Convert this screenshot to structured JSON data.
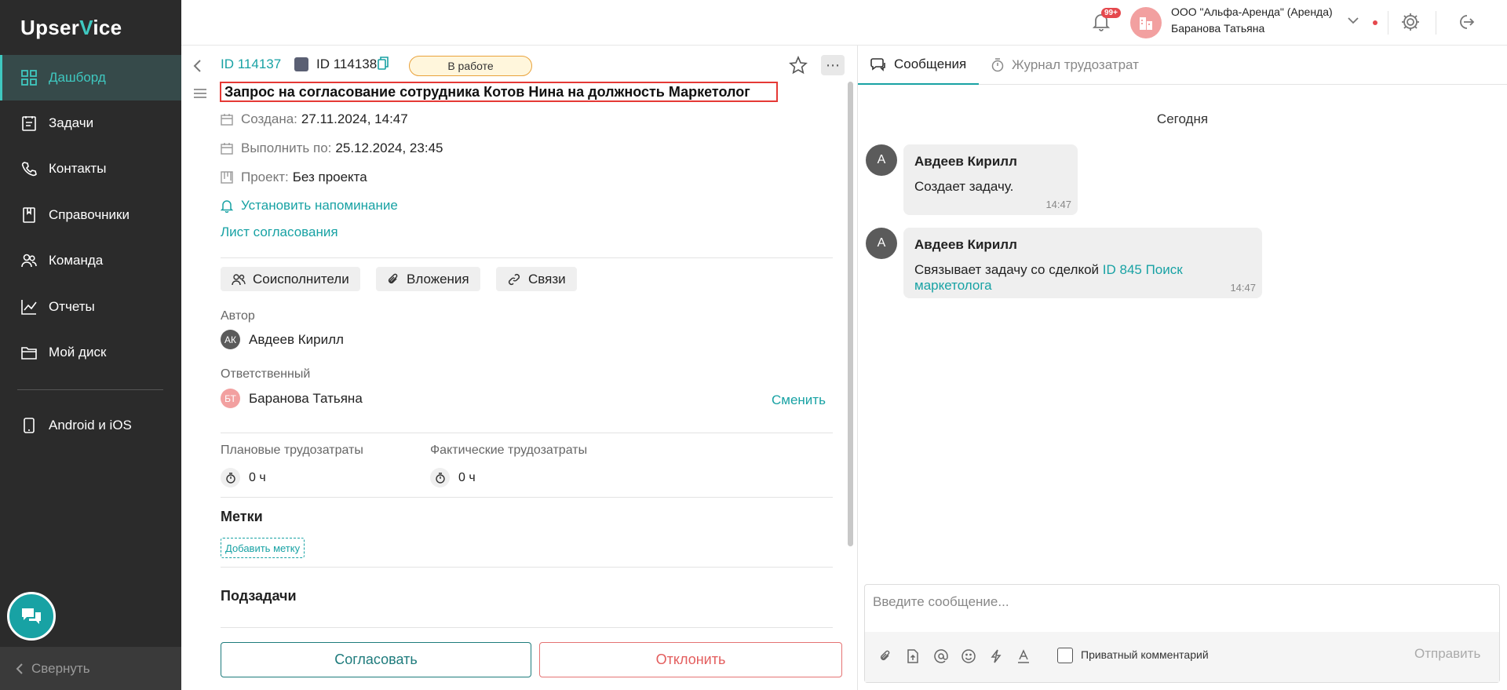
{
  "sidebar": {
    "logo_prefix": "Upser",
    "logo_v": "V",
    "logo_suffix": "ice",
    "items": [
      {
        "label": "Дашборд",
        "icon": "dashboard-icon"
      },
      {
        "label": "Задачи",
        "icon": "tasks-icon"
      },
      {
        "label": "Контакты",
        "icon": "contacts-icon"
      },
      {
        "label": "Справочники",
        "icon": "book-icon"
      },
      {
        "label": "Команда",
        "icon": "team-icon"
      },
      {
        "label": "Отчеты",
        "icon": "chart-icon"
      },
      {
        "label": "Мой диск",
        "icon": "folder-icon"
      },
      {
        "label": "Android и iOS",
        "icon": "phone-icon"
      }
    ],
    "active_index": 0,
    "collapse_label": "Свернуть"
  },
  "topbar": {
    "notifications_badge": "99+",
    "org_name": "ООО \"Альфа-Аренда\" (Аренда)",
    "user_name": "Баранова Татьяна"
  },
  "task": {
    "parent_id": "ID 114137",
    "current_id": "ID 114138",
    "status": "В работе",
    "title": "Запрос на согласование сотрудника Котов Нина на должность Маркетолог",
    "created_label": "Создана:",
    "created_value": "27.11.2024, 14:47",
    "due_label": "Выполнить по:",
    "due_value": "25.12.2024, 23:45",
    "project_label": "Проект:",
    "project_value": "Без проекта",
    "reminder_label": "Установить напоминание",
    "approval_list_label": "Лист согласования",
    "chips": [
      "Соисполнители",
      "Вложения",
      "Связи"
    ],
    "author_label": "Автор",
    "author_initials": "АК",
    "author_name": "Авдеев Кирилл",
    "responsible_label": "Ответственный",
    "responsible_initials": "БТ",
    "responsible_name": "Баранова Татьяна",
    "change_label": "Сменить",
    "planned_label": "Плановые трудозатраты",
    "planned_value": "0 ч",
    "actual_label": "Фактические трудозатраты",
    "actual_value": "0 ч",
    "tags_title": "Метки",
    "add_tag_label": "Добавить метку",
    "subtasks_title": "Подзадачи",
    "approve_label": "Согласовать",
    "reject_label": "Отклонить"
  },
  "chat": {
    "tabs": [
      "Сообщения",
      "Журнал трудозатрат"
    ],
    "active_tab": 0,
    "date_label": "Сегодня",
    "messages": [
      {
        "avatar": "А",
        "author": "Авдеев Кирилл",
        "text": "Создает задачу.",
        "link": "",
        "time": "14:47"
      },
      {
        "avatar": "А",
        "author": "Авдеев Кирилл",
        "text": "Связывает задачу со сделкой ",
        "link": "ID 845 Поиск маркетолога",
        "time": "14:47"
      }
    ],
    "input_placeholder": "Введите сообщение...",
    "private_label": "Приватный комментарий",
    "private_checked": false,
    "send_label": "Отправить"
  },
  "colors": {
    "accent": "#18a2a4",
    "sidebar_bg": "#2b2b2b",
    "status_border": "#e9a23b",
    "reject": "#e35d5d",
    "highlight_border": "#e53935"
  }
}
